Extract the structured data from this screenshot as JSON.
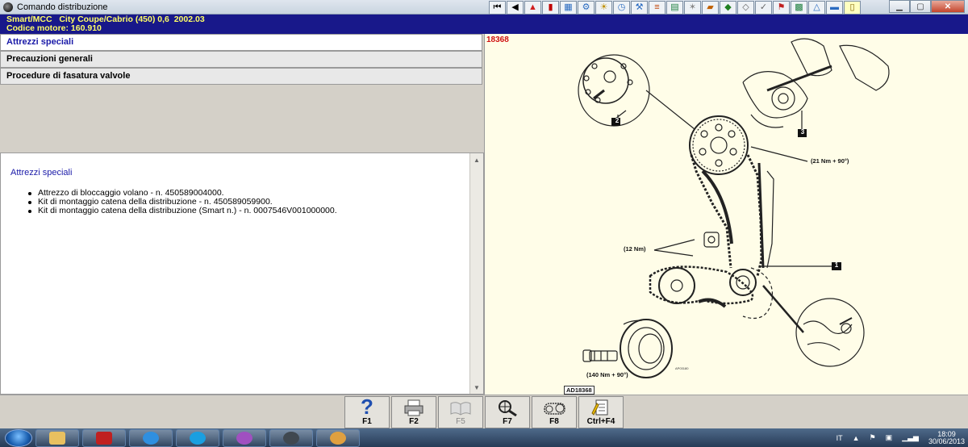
{
  "window": {
    "title": "Comando distribuzione"
  },
  "vehicle": {
    "line1": "Smart/MCC   City Coupe/Cabrio (450) 0,6  2002.03",
    "line2": "Codice motore: 160.910"
  },
  "tabs": [
    {
      "label": "Attrezzi speciali",
      "active": true
    },
    {
      "label": "Precauzioni generali",
      "active": false
    },
    {
      "label": "Procedure di fasatura valvole",
      "active": false
    }
  ],
  "content": {
    "title": "Attrezzi speciali",
    "items": [
      "Attrezzo di bloccaggio volano - n. 450589004000.",
      "Kit di montaggio catena della distribuzione - n. 450589059900.",
      "Kit di montaggio catena della distribuzione (Smart n.) - n. 0007546V001000000."
    ]
  },
  "diagram": {
    "ref": "18368",
    "torque_top": "(21 Nm + 90°)",
    "torque_mid": "(12 Nm)",
    "torque_bottom": "(140 Nm + 90°)",
    "callouts": [
      "1",
      "2",
      "3"
    ],
    "code_small": "AP03180",
    "code": "AD18368"
  },
  "toolbar": {
    "icons": [
      "first-icon",
      "back-icon",
      "warning-icon",
      "book-icon",
      "chart-icon",
      "gear-icon",
      "sun-icon",
      "clock-icon",
      "wrench-icon",
      "tools-icon",
      "document-icon",
      "spray-icon",
      "battery-icon",
      "car-icon",
      "car-outline-icon",
      "check-icon",
      "flag-icon",
      "grid-icon",
      "triangle-icon",
      "car-blue-icon",
      "note-icon"
    ]
  },
  "fkeys": [
    {
      "label": "F1",
      "icon": "help-icon",
      "enabled": true
    },
    {
      "label": "F2",
      "icon": "printer-icon",
      "enabled": true
    },
    {
      "label": "F5",
      "icon": "open-book-icon",
      "enabled": false
    },
    {
      "label": "F7",
      "icon": "zoom-icon",
      "enabled": true
    },
    {
      "label": "F8",
      "icon": "belt-icon",
      "enabled": true
    },
    {
      "label": "Ctrl+F4",
      "icon": "notepad-icon",
      "enabled": true
    }
  ],
  "taskbar": {
    "language": "IT",
    "time": "18:09",
    "date": "30/06/2013",
    "apps": [
      "file-manager-icon",
      "app-red-icon",
      "ie-icon",
      "skype-icon",
      "media-icon",
      "app-dark-icon",
      "paint-icon"
    ]
  },
  "colors": {
    "infobar_bg": "#18188a",
    "infobar_text": "#ffff66",
    "active_tab_text": "#1a1aa8",
    "ref_text": "#d01010",
    "diagram_bg": "#fffde8"
  }
}
